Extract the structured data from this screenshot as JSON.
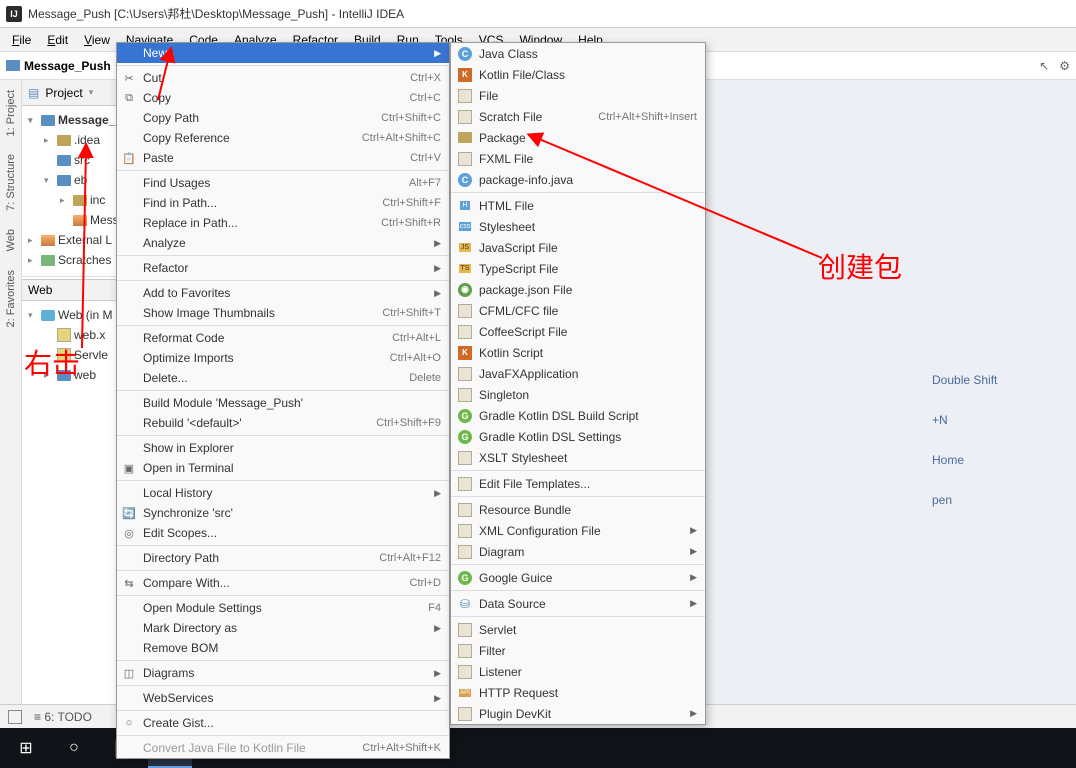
{
  "title": "Message_Push [C:\\Users\\邦杜\\Desktop\\Message_Push] - IntelliJ IDEA",
  "menubar": [
    "File",
    "Edit",
    "View",
    "Navigate",
    "Code",
    "Analyze",
    "Refactor",
    "Build",
    "Run",
    "Tools",
    "VCS",
    "Window",
    "Help"
  ],
  "breadcrumb": "Message_Push",
  "project": {
    "header": "Project",
    "items": [
      {
        "label": "Message_",
        "bold": true,
        "icon": "folder-blue",
        "arrow": "v",
        "indent": 0
      },
      {
        "label": ".idea",
        "icon": "folder-brown",
        "arrow": ">",
        "indent": 1
      },
      {
        "label": "src",
        "icon": "folder-blue",
        "arrow": "",
        "indent": 1
      },
      {
        "label": "eb",
        "icon": "folder-blue",
        "arrow": "v",
        "indent": 1
      },
      {
        "label": "inc",
        "icon": "folder-brown",
        "arrow": ">",
        "indent": 2
      },
      {
        "label": "Messa",
        "icon": "lib",
        "arrow": "",
        "indent": 2
      },
      {
        "label": "External L",
        "icon": "lib",
        "arrow": ">",
        "indent": 0
      },
      {
        "label": "Scratches",
        "icon": "scratch",
        "arrow": ">",
        "indent": 0
      }
    ],
    "web_header": "Web",
    "web_tree": [
      {
        "label": "Web (in M",
        "icon": "web",
        "arrow": "v",
        "indent": 0
      },
      {
        "label": "web.x",
        "icon": "xml",
        "arrow": "",
        "indent": 1
      },
      {
        "label": "Servle",
        "icon": "xml",
        "arrow": "",
        "indent": 1
      },
      {
        "label": "web",
        "icon": "folder-blue",
        "arrow": ">",
        "indent": 1
      }
    ]
  },
  "context_menu": [
    {
      "label": "New",
      "hl": true,
      "submenu": true
    },
    {
      "sep": true
    },
    {
      "label": "Cut",
      "sc": "Ctrl+X",
      "icon": "scissors"
    },
    {
      "label": "Copy",
      "sc": "Ctrl+C",
      "icon": "copy"
    },
    {
      "label": "Copy Path",
      "sc": "Ctrl+Shift+C"
    },
    {
      "label": "Copy Reference",
      "sc": "Ctrl+Alt+Shift+C"
    },
    {
      "label": "Paste",
      "sc": "Ctrl+V",
      "icon": "paste"
    },
    {
      "sep": true
    },
    {
      "label": "Find Usages",
      "sc": "Alt+F7"
    },
    {
      "label": "Find in Path...",
      "sc": "Ctrl+Shift+F"
    },
    {
      "label": "Replace in Path...",
      "sc": "Ctrl+Shift+R"
    },
    {
      "label": "Analyze",
      "submenu": true
    },
    {
      "sep": true
    },
    {
      "label": "Refactor",
      "submenu": true
    },
    {
      "sep": true
    },
    {
      "label": "Add to Favorites",
      "submenu": true
    },
    {
      "label": "Show Image Thumbnails",
      "sc": "Ctrl+Shift+T"
    },
    {
      "sep": true
    },
    {
      "label": "Reformat Code",
      "sc": "Ctrl+Alt+L"
    },
    {
      "label": "Optimize Imports",
      "sc": "Ctrl+Alt+O"
    },
    {
      "label": "Delete...",
      "sc": "Delete"
    },
    {
      "sep": true
    },
    {
      "label": "Build Module 'Message_Push'"
    },
    {
      "label": "Rebuild '<default>'",
      "sc": "Ctrl+Shift+F9"
    },
    {
      "sep": true
    },
    {
      "label": "Show in Explorer"
    },
    {
      "label": "Open in Terminal",
      "icon": "terminal"
    },
    {
      "sep": true
    },
    {
      "label": "Local History",
      "submenu": true
    },
    {
      "label": "Synchronize 'src'",
      "icon": "sync"
    },
    {
      "label": "Edit Scopes...",
      "icon": "scope"
    },
    {
      "sep": true
    },
    {
      "label": "Directory Path",
      "sc": "Ctrl+Alt+F12"
    },
    {
      "sep": true
    },
    {
      "label": "Compare With...",
      "sc": "Ctrl+D",
      "icon": "compare"
    },
    {
      "sep": true
    },
    {
      "label": "Open Module Settings",
      "sc": "F4"
    },
    {
      "label": "Mark Directory as",
      "submenu": true
    },
    {
      "label": "Remove BOM"
    },
    {
      "sep": true
    },
    {
      "label": "Diagrams",
      "submenu": true,
      "icon": "diagram"
    },
    {
      "sep": true
    },
    {
      "label": "WebServices",
      "submenu": true
    },
    {
      "sep": true
    },
    {
      "label": "Create Gist...",
      "icon": "gist"
    },
    {
      "sep": true
    },
    {
      "label": "Convert Java File to Kotlin File",
      "sc": "Ctrl+Alt+Shift+K",
      "disabled": true
    }
  ],
  "new_submenu": [
    {
      "label": "Java Class",
      "icon": "class-c"
    },
    {
      "label": "Kotlin File/Class",
      "icon": "kt"
    },
    {
      "label": "File",
      "icon": "file"
    },
    {
      "label": "Scratch File",
      "sc": "Ctrl+Alt+Shift+Insert",
      "icon": "scratch"
    },
    {
      "label": "Package",
      "icon": "pkg"
    },
    {
      "label": "FXML File",
      "icon": "file"
    },
    {
      "label": "package-info.java",
      "icon": "class-c"
    },
    {
      "sep": true
    },
    {
      "label": "HTML File",
      "icon": "html"
    },
    {
      "label": "Stylesheet",
      "icon": "css"
    },
    {
      "label": "JavaScript File",
      "icon": "js"
    },
    {
      "label": "TypeScript File",
      "icon": "ts"
    },
    {
      "label": "package.json File",
      "icon": "json"
    },
    {
      "label": "CFML/CFC file",
      "icon": "cf"
    },
    {
      "label": "CoffeeScript File",
      "icon": "coffee"
    },
    {
      "label": "Kotlin Script",
      "icon": "kt"
    },
    {
      "label": "JavaFXApplication",
      "icon": "fx"
    },
    {
      "label": "Singleton",
      "icon": "pattern"
    },
    {
      "label": "Gradle Kotlin DSL Build Script",
      "icon": "gradle-g"
    },
    {
      "label": "Gradle Kotlin DSL Settings",
      "icon": "gradle-g"
    },
    {
      "label": "XSLT Stylesheet",
      "icon": "xslt"
    },
    {
      "sep": true
    },
    {
      "label": "Edit File Templates..."
    },
    {
      "sep": true
    },
    {
      "label": "Resource Bundle",
      "icon": "bundle"
    },
    {
      "label": "XML Configuration File",
      "icon": "xml",
      "submenu": true
    },
    {
      "label": "Diagram",
      "submenu": true
    },
    {
      "sep": true
    },
    {
      "label": "Google Guice",
      "icon": "guice-g",
      "submenu": true
    },
    {
      "sep": true
    },
    {
      "label": "Data Source",
      "icon": "db",
      "submenu": true
    },
    {
      "sep": true
    },
    {
      "label": "Servlet",
      "icon": "servlet"
    },
    {
      "label": "Filter",
      "icon": "filter"
    },
    {
      "label": "Listener",
      "icon": "listener"
    },
    {
      "label": "HTTP Request",
      "icon": "api"
    },
    {
      "label": "Plugin DevKit",
      "icon": "plugin",
      "submenu": true
    }
  ],
  "hints": [
    "Double Shift",
    "+N",
    "Home",
    "pen"
  ],
  "annotations": {
    "left": "右击",
    "right": "创建包"
  },
  "left_tabs": [
    "1: Project",
    "7: Structure",
    "Web",
    "2: Favorites"
  ],
  "statusbar_left": "6: TODO"
}
